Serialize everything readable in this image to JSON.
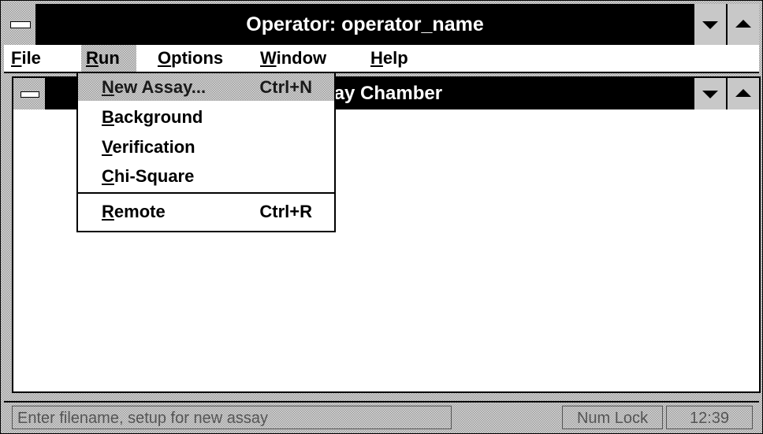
{
  "window": {
    "title": "Operator: operator_name"
  },
  "menubar": {
    "items": [
      {
        "label": "File",
        "mnemonic": "F",
        "rest": "ile"
      },
      {
        "label": "Run",
        "mnemonic": "R",
        "rest": "un"
      },
      {
        "label": "Options",
        "mnemonic": "O",
        "rest": "ptions"
      },
      {
        "label": "Window",
        "mnemonic": "W",
        "rest": "indow"
      },
      {
        "label": "Help",
        "mnemonic": "H",
        "rest": "elp"
      }
    ]
  },
  "child_window": {
    "title": "ssay Chamber"
  },
  "run_menu": {
    "items": [
      {
        "mnemonic": "N",
        "rest": "ew Assay...",
        "shortcut": "Ctrl+N"
      },
      {
        "mnemonic": "B",
        "rest": "ackground",
        "shortcut": ""
      },
      {
        "mnemonic": "V",
        "rest": "erification",
        "shortcut": ""
      },
      {
        "mnemonic": "C",
        "rest": "hi-Square",
        "shortcut": ""
      },
      {
        "mnemonic": "R",
        "rest": "emote",
        "shortcut": "Ctrl+R"
      }
    ]
  },
  "statusbar": {
    "message": "Enter filename, setup for new assay",
    "num_lock": "Num Lock",
    "time": "12:39"
  }
}
